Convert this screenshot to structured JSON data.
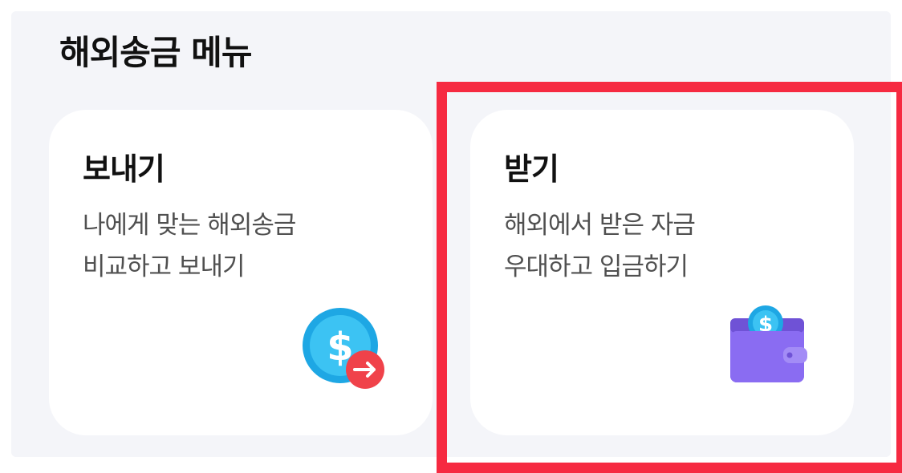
{
  "menu": {
    "title": "해외송금 메뉴"
  },
  "cards": {
    "send": {
      "title": "보내기",
      "desc_line1": "나에게 맞는 해외송금",
      "desc_line2": "비교하고 보내기",
      "icon": "dollar-coin-arrow-icon"
    },
    "receive": {
      "title": "받기",
      "desc_line1": "해외에서 받은 자금",
      "desc_line2": "우대하고 입금하기",
      "icon": "wallet-coin-icon"
    }
  },
  "colors": {
    "panel_bg": "#f4f5f9",
    "card_bg": "#ffffff",
    "highlight": "#f62a41",
    "coin_blue": "#1ea7e4",
    "arrow_red": "#f0424a",
    "wallet_purple": "#8a6cf2"
  }
}
